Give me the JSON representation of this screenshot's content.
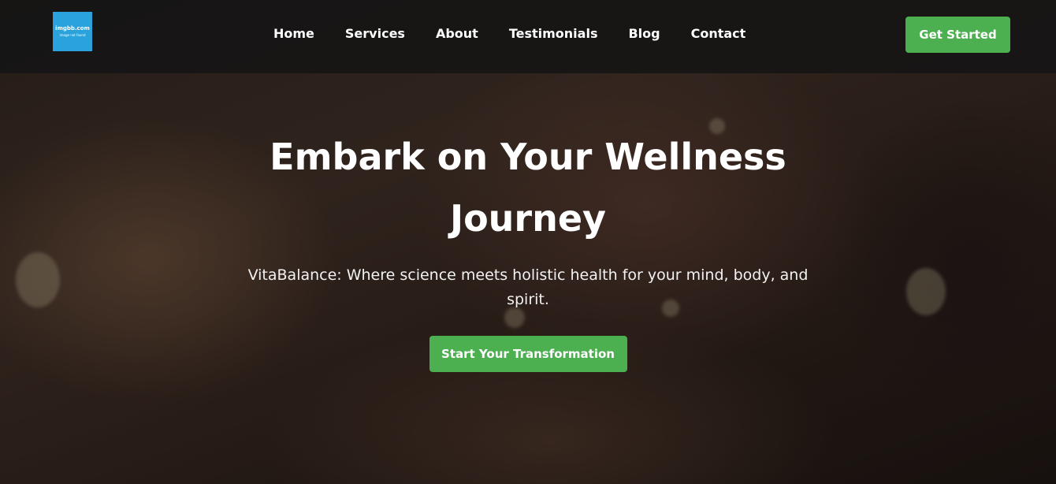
{
  "nav": {
    "logo_text": "imgbb.com",
    "logo_subtext": "image not found",
    "links": [
      "Home",
      "Services",
      "About",
      "Testimonials",
      "Blog",
      "Contact"
    ],
    "cta_label": "Get Started"
  },
  "hero": {
    "title": "Embark on Your Wellness Journey",
    "subtitle": "VitaBalance: Where science meets holistic health for your mind, body, and spirit.",
    "cta_label": "Start Your Transformation"
  },
  "colors": {
    "accent": "#4caf50",
    "logo_bg": "#2aa3dd"
  }
}
